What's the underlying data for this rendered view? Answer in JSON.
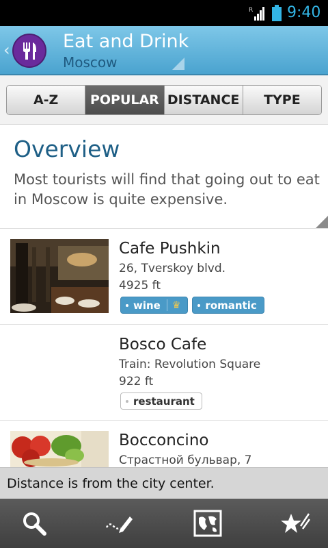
{
  "status_bar": {
    "time": "9:40",
    "roaming_indicator": "R"
  },
  "header": {
    "back_glyph": "‹",
    "title": "Eat and Drink",
    "subtitle": "Moscow",
    "logo_icon": "fork-knife-icon"
  },
  "tabs": [
    {
      "label": "A-Z",
      "active": false
    },
    {
      "label": "POPULAR",
      "active": true
    },
    {
      "label": "DISTANCE",
      "active": false
    },
    {
      "label": "TYPE",
      "active": false
    }
  ],
  "overview": {
    "heading": "Overview",
    "text": "Most tourists will find that going out to eat in Moscow is quite expensive."
  },
  "places": [
    {
      "name": "Cafe Pushkin",
      "address": "26, Tverskoy blvd.",
      "distance": "4925 ft",
      "tags": [
        {
          "label": "wine",
          "badge": "crown"
        },
        {
          "label": "romantic"
        }
      ]
    },
    {
      "name": "Bosco Cafe",
      "address": "Train: Revolution Square",
      "distance": "922 ft",
      "tags": [
        {
          "label": "restaurant"
        }
      ]
    },
    {
      "name": "Bocconcino",
      "address": "Страстной бульвар, 7"
    }
  ],
  "footer_note": "Distance is from the city center.",
  "bottom_bar": [
    "search-icon",
    "edit-note-icon",
    "map-icon",
    "favorites-icon"
  ],
  "colors": {
    "accent": "#33b5e5",
    "header_blue": "#4aa3cf",
    "title_blue": "#1e5f86",
    "tag_blue": "#4a9ac7"
  }
}
